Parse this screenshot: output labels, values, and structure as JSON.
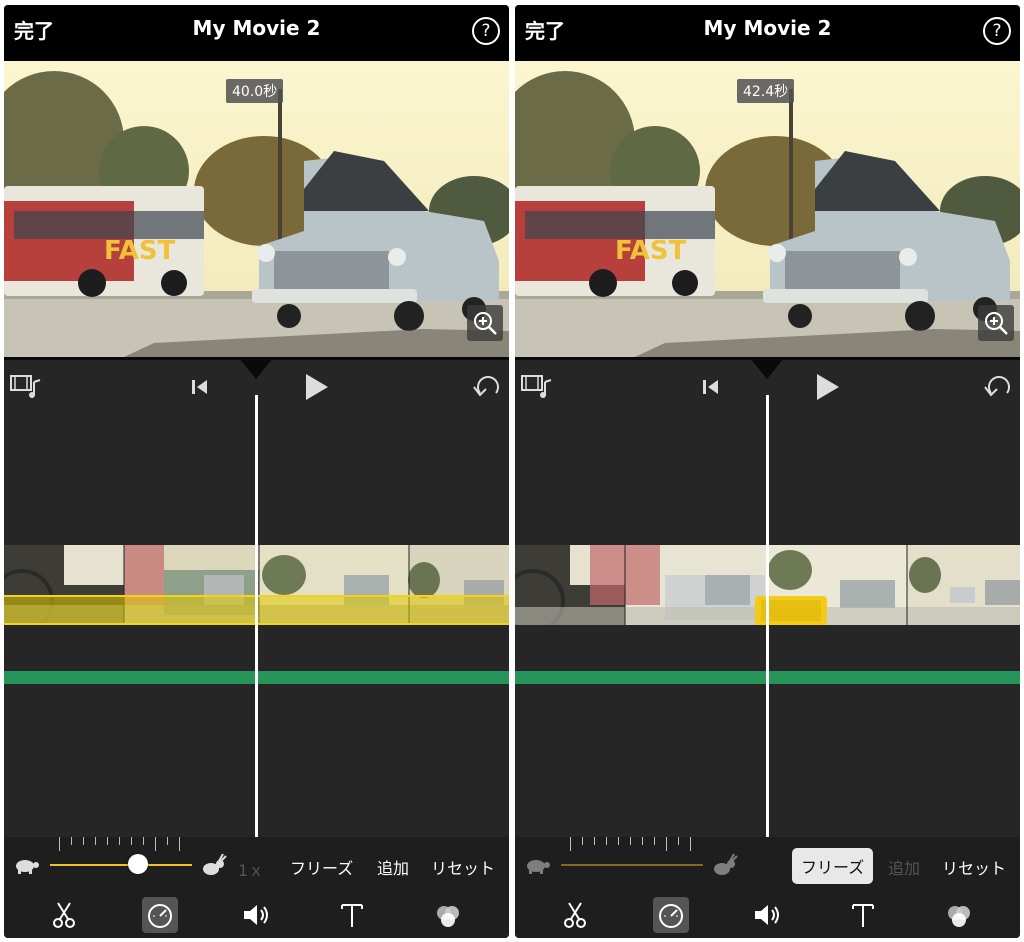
{
  "screens": [
    {
      "done_label": "完了",
      "title": "My Movie 2",
      "help_label": "?",
      "time_badge": "40.0秒",
      "speed_label": "1ｘ",
      "freeze_label": "フリーズ",
      "add_label": "追加",
      "reset_label": "リセット",
      "speed_slider_value": 0.62,
      "freeze_selected": false,
      "add_enabled": true
    },
    {
      "done_label": "完了",
      "title": "My Movie 2",
      "help_label": "?",
      "time_badge": "42.4秒",
      "speed_label": "",
      "freeze_label": "フリーズ",
      "add_label": "追加",
      "reset_label": "リセット",
      "speed_slider_value": null,
      "freeze_selected": true,
      "add_enabled": false
    }
  ],
  "icons": {
    "film_audio": "film-music-icon",
    "skip_start": "skip-to-start-icon",
    "play": "play-icon",
    "undo": "undo-icon",
    "zoom": "zoom-in-icon",
    "turtle": "turtle-icon",
    "rabbit": "rabbit-icon",
    "scissors": "scissors-icon",
    "speed": "speedometer-icon",
    "volume": "volume-icon",
    "title": "title-text-icon",
    "filter": "filters-icon"
  },
  "colors": {
    "accent_yellow": "#f3d21b",
    "audio_green": "#27955a",
    "timeline_bg": "#262626"
  }
}
